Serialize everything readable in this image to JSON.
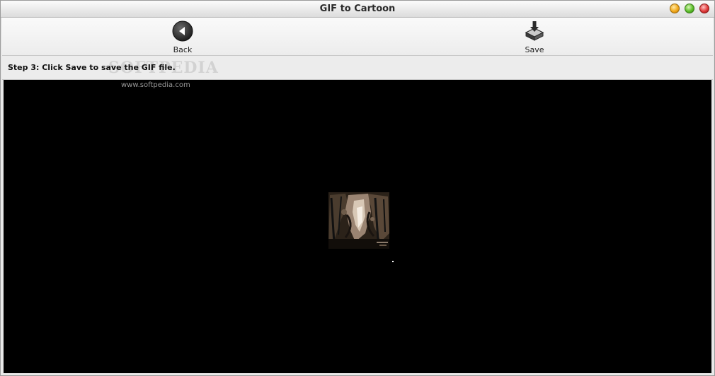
{
  "window": {
    "title": "GIF to Cartoon",
    "controls": [
      "minimize-icon",
      "maximize-icon",
      "close-icon"
    ]
  },
  "toolbar": {
    "back_label": "Back",
    "back_icon": "arrow-left-circle-icon",
    "save_label": "Save",
    "save_icon": "save-download-icon"
  },
  "step": {
    "text": "Step 3: Click Save to save the GIF file."
  },
  "watermark": {
    "logo": "SOFTPEDIA",
    "url": "www.softpedia.com"
  },
  "colors": {
    "canvas_background": "#000000",
    "window_background": "#e9e9e9"
  }
}
